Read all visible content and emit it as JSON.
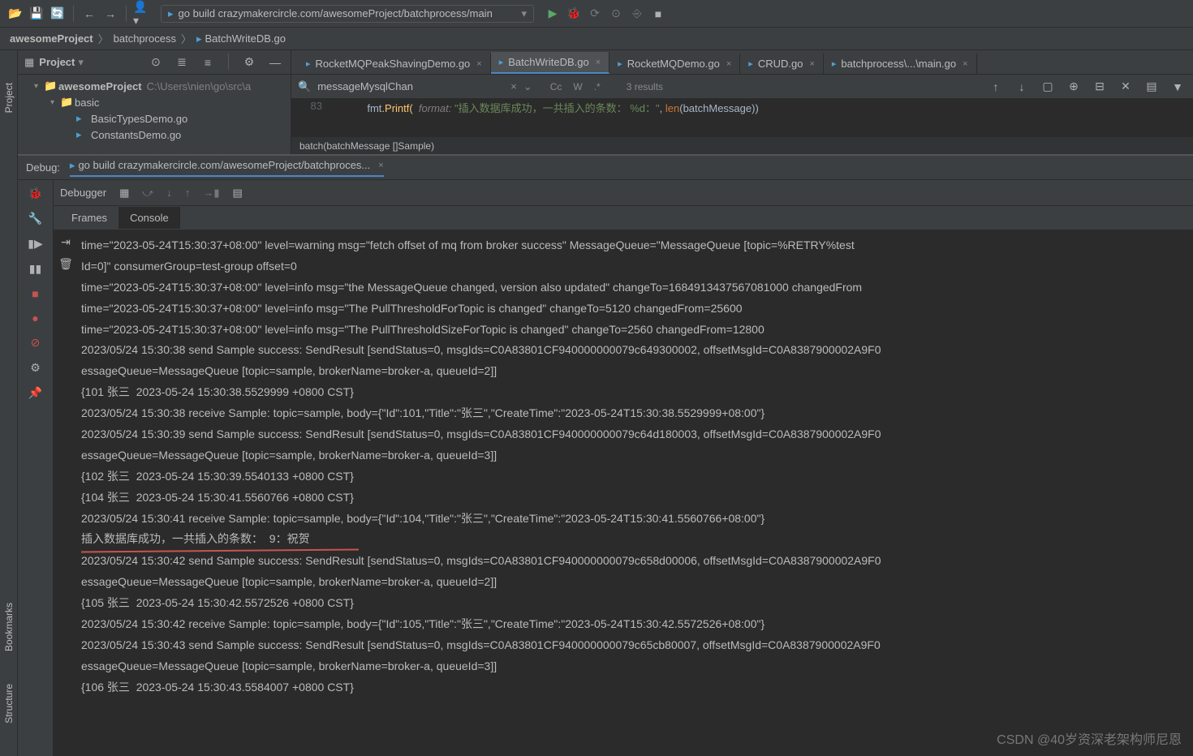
{
  "toolbar": {
    "run_config_text": "go build crazymakercircle.com/awesomeProject/batchprocess/main"
  },
  "breadcrumb": {
    "items": [
      "awesomeProject",
      "batchprocess",
      "BatchWriteDB.go"
    ]
  },
  "project_panel": {
    "title": "Project",
    "root": "awesomeProject",
    "root_path": "C:\\Users\\nien\\go\\src\\a",
    "folder": "basic",
    "files": [
      "BasicTypesDemo.go",
      "ConstantsDemo.go"
    ]
  },
  "editor": {
    "tabs": [
      {
        "label": "RocketMQPeakShavingDemo.go",
        "active": false
      },
      {
        "label": "BatchWriteDB.go",
        "active": true
      },
      {
        "label": "RocketMQDemo.go",
        "active": false
      },
      {
        "label": "CRUD.go",
        "active": false
      },
      {
        "label": "batchprocess\\...\\main.go",
        "active": false
      }
    ],
    "find_value": "messageMysqlChan",
    "find_results": "3 results",
    "line_no": "83",
    "code_fmt": "fmt",
    "code_printf": ".Printf(",
    "code_format": "  format: ",
    "code_str": "\"插入数据库成功，一共插入的条数： %d：\"",
    "code_sep": ", ",
    "code_len": "len",
    "code_args": "(batchMessage))",
    "breadcrumb_code": "batch(batchMessage []Sample)"
  },
  "debug": {
    "label": "Debug:",
    "config": "go build crazymakercircle.com/awesomeProject/batchproces...",
    "tab_debugger": "Debugger",
    "subtab_frames": "Frames",
    "subtab_console": "Console",
    "console_lines": [
      "time=\"2023-05-24T15:30:37+08:00\" level=warning msg=\"fetch offset of mq from broker success\" MessageQueue=\"MessageQueue [topic=%RETRY%test",
      "Id=0]\" consumerGroup=test-group offset=0",
      "time=\"2023-05-24T15:30:37+08:00\" level=info msg=\"the MessageQueue changed, version also updated\" changeTo=1684913437567081000 changedFrom",
      "time=\"2023-05-24T15:30:37+08:00\" level=info msg=\"The PullThresholdForTopic is changed\" changeTo=5120 changedFrom=25600",
      "time=\"2023-05-24T15:30:37+08:00\" level=info msg=\"The PullThresholdSizeForTopic is changed\" changeTo=2560 changedFrom=12800",
      "2023/05/24 15:30:38 send Sample success: SendResult [sendStatus=0, msgIds=C0A83801CF940000000079c649300002, offsetMsgId=C0A8387900002A9F0",
      "essageQueue=MessageQueue [topic=sample, brokerName=broker-a, queueId=2]]",
      "{101 张三  2023-05-24 15:30:38.5529999 +0800 CST}",
      "2023/05/24 15:30:38 receive Sample: topic=sample, body={\"Id\":101,\"Title\":\"张三\",\"CreateTime\":\"2023-05-24T15:30:38.5529999+08:00\"}",
      "2023/05/24 15:30:39 send Sample success: SendResult [sendStatus=0, msgIds=C0A83801CF940000000079c64d180003, offsetMsgId=C0A8387900002A9F0",
      "essageQueue=MessageQueue [topic=sample, brokerName=broker-a, queueId=3]]",
      "{102 张三  2023-05-24 15:30:39.5540133 +0800 CST}",
      "{104 张三  2023-05-24 15:30:41.5560766 +0800 CST}",
      "2023/05/24 15:30:41 receive Sample: topic=sample, body={\"Id\":104,\"Title\":\"张三\",\"CreateTime\":\"2023-05-24T15:30:41.5560766+08:00\"}",
      "插入数据库成功，一共插入的条数：  9：祝贺",
      "2023/05/24 15:30:42 send Sample success: SendResult [sendStatus=0, msgIds=C0A83801CF940000000079c658d00006, offsetMsgId=C0A8387900002A9F0",
      "essageQueue=MessageQueue [topic=sample, brokerName=broker-a, queueId=2]]",
      "{105 张三  2023-05-24 15:30:42.5572526 +0800 CST}",
      "2023/05/24 15:30:42 receive Sample: topic=sample, body={\"Id\":105,\"Title\":\"张三\",\"CreateTime\":\"2023-05-24T15:30:42.5572526+08:00\"}",
      "2023/05/24 15:30:43 send Sample success: SendResult [sendStatus=0, msgIds=C0A83801CF940000000079c65cb80007, offsetMsgId=C0A8387900002A9F0",
      "essageQueue=MessageQueue [topic=sample, brokerName=broker-a, queueId=3]]",
      "{106 张三  2023-05-24 15:30:43.5584007 +0800 CST}"
    ]
  },
  "left_rails": [
    "Project",
    "Bookmarks",
    "Structure"
  ],
  "watermark": "CSDN @40岁资深老架构师尼恩"
}
